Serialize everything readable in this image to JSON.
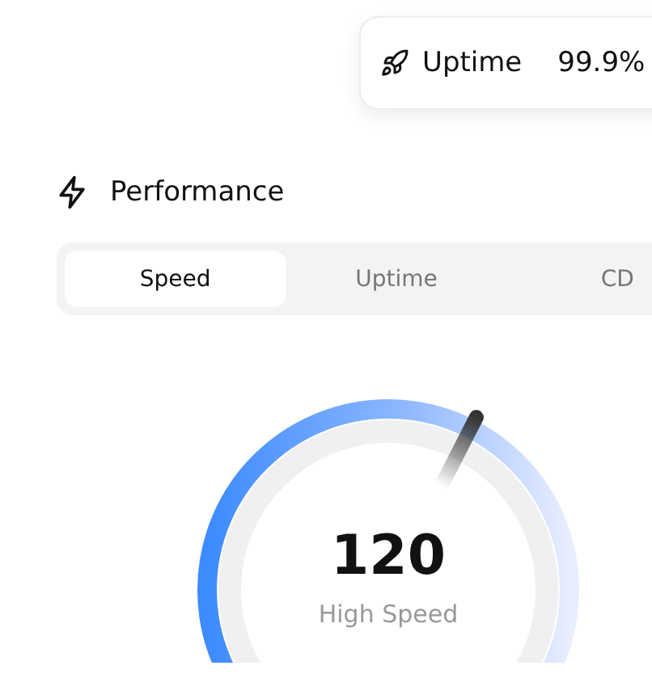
{
  "status_card": {
    "label": "Uptime",
    "value": "99.9%"
  },
  "section": {
    "title": "Performance"
  },
  "tabs": [
    {
      "label": "Speed",
      "selected": true
    },
    {
      "label": "Uptime",
      "selected": false
    },
    {
      "label": "CD",
      "selected": false
    }
  ],
  "gauge": {
    "value": "120",
    "caption": "High Speed"
  }
}
